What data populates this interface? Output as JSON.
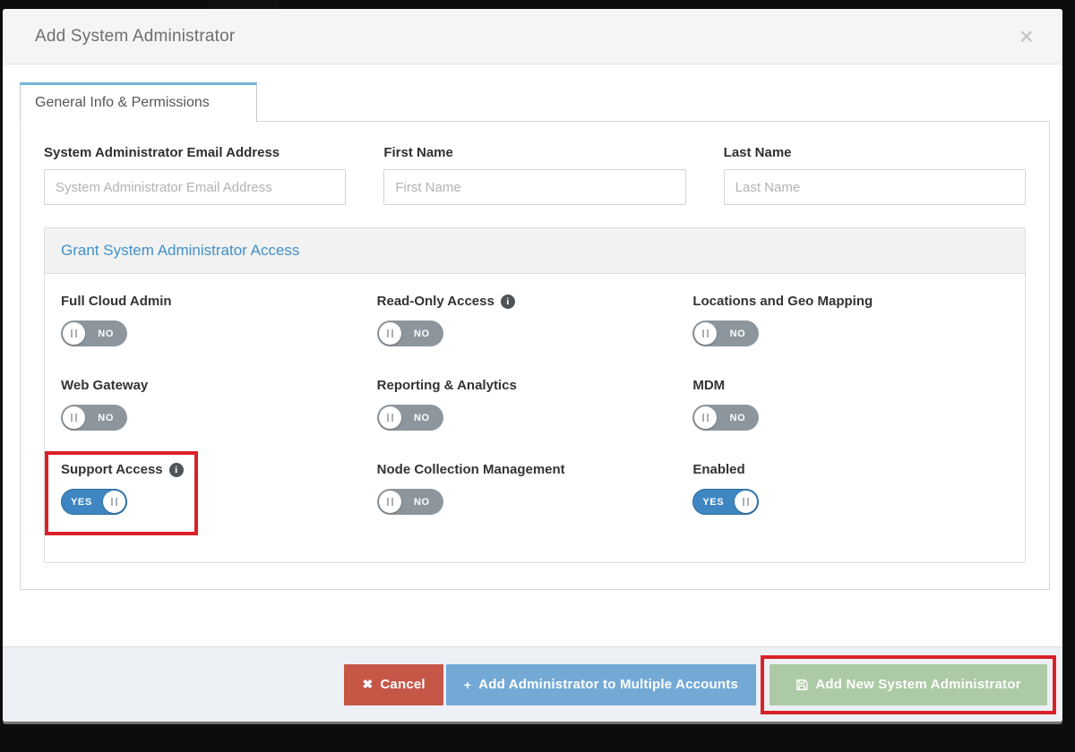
{
  "modal": {
    "title": "Add System Administrator",
    "close_icon": "×"
  },
  "tab": {
    "label": "General Info & Permissions"
  },
  "form": {
    "fields": [
      {
        "label": "System Administrator Email Address",
        "placeholder": "System Administrator Email Address",
        "value": ""
      },
      {
        "label": "First Name",
        "placeholder": "First Name",
        "value": ""
      },
      {
        "label": "Last Name",
        "placeholder": "Last Name",
        "value": ""
      }
    ]
  },
  "permissions": {
    "section_title": "Grant System Administrator Access",
    "on_label": "YES",
    "off_label": "NO",
    "info_icon_glyph": "i",
    "toggles": [
      {
        "label": "Full Cloud Admin",
        "state": "NO",
        "info": false,
        "highlighted": false
      },
      {
        "label": "Read-Only Access",
        "state": "NO",
        "info": true,
        "highlighted": false
      },
      {
        "label": "Locations and Geo Mapping",
        "state": "NO",
        "info": false,
        "highlighted": false
      },
      {
        "label": "Web Gateway",
        "state": "NO",
        "info": false,
        "highlighted": false
      },
      {
        "label": "Reporting & Analytics",
        "state": "NO",
        "info": false,
        "highlighted": false
      },
      {
        "label": "MDM",
        "state": "NO",
        "info": false,
        "highlighted": false
      },
      {
        "label": "Support Access",
        "state": "YES",
        "info": true,
        "highlighted": true
      },
      {
        "label": "Node Collection Management",
        "state": "NO",
        "info": false,
        "highlighted": false
      },
      {
        "label": "Enabled",
        "state": "YES",
        "info": false,
        "highlighted": false
      }
    ]
  },
  "footer": {
    "cancel_label": "Cancel",
    "cancel_icon": "✖",
    "add_multiple_label": "Add Administrator to Multiple Accounts",
    "add_multiple_icon": "+",
    "save_label": "Add New System Administrator"
  },
  "colors": {
    "accent_blue": "#4191c9",
    "tab_accent": "#72b4d8",
    "toggle_on": "#3e86c2",
    "toggle_off": "#8d969c",
    "cancel_red": "#c65747",
    "multiple_blue": "#74a9d6",
    "save_green": "#abcaa5",
    "annotation_red": "#da2128"
  }
}
